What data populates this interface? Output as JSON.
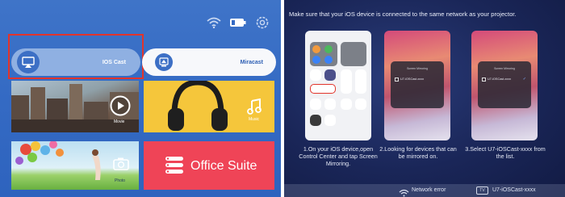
{
  "left_panel": {
    "ios_cast_label": "IOS Cast",
    "miracast_label": "Miracast",
    "movie_label": "Movie",
    "music_label": "Music",
    "photo_label": "Photo",
    "office_label": "Office Suite",
    "highlight_color": "#e2342b",
    "status_icons": [
      "wifi-icon",
      "battery-icon",
      "settings-gear-icon"
    ]
  },
  "right_panel": {
    "headline": "Make sure that your iOS device is connected to the same network as your projector.",
    "popup_title": "Screen Mirroring",
    "popup_device": "U7-iOSCast-xxxx",
    "steps": [
      {
        "caption": "1.On your iOS device,open Control Center and tap Screen Mirroring."
      },
      {
        "caption": "2.Looking for devices that can be mirrored on."
      },
      {
        "caption": "3.Select U7-iOSCast-xxxx from the list."
      }
    ],
    "bottom_bar": {
      "network_status": "Network error",
      "tv_icon_label": "TV",
      "device_name": "U7-iOSCast-xxxx"
    }
  }
}
